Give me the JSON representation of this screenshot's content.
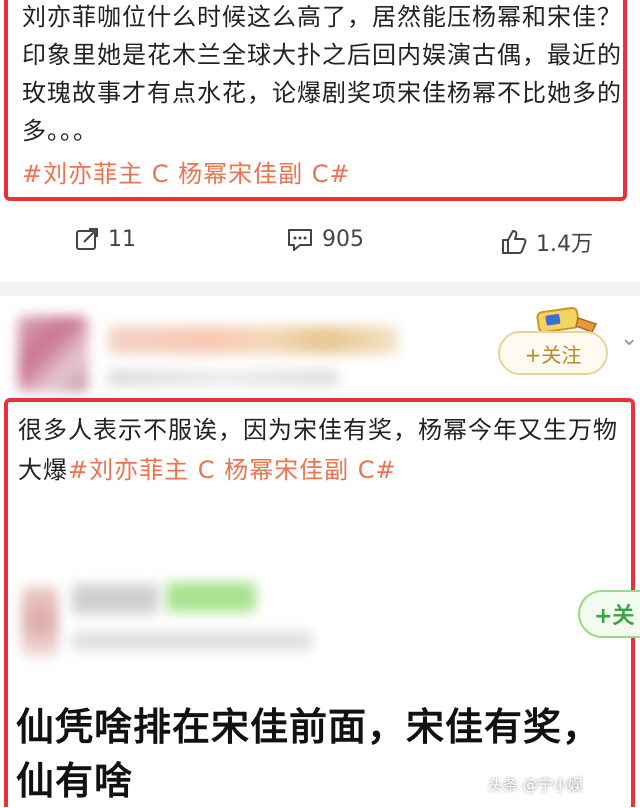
{
  "post1": {
    "text": "刘亦菲咖位什么时候这么高了，居然能压杨幂和宋佳？印象里她是花木兰全球大扑之后回内娱演古偶，最近的玫瑰故事才有点水花，论爆剧奖项宋佳杨幂不比她多的多。。。",
    "hashtag": "#刘亦菲主 C 杨幂宋佳副 C#"
  },
  "actions": {
    "repost_count": "11",
    "comment_count": "905",
    "like_count": "1.4万"
  },
  "comment_header": {
    "follow_label": "+关注"
  },
  "post2": {
    "text": "很多人表示不服诶，因为宋佳有奖，杨幂今年又生万物大爆",
    "hashtag": "#刘亦菲主 C 杨幂宋佳副 C#",
    "inner_follow_label": "+关",
    "big_line1": "仙凭啥排在宋佳前面，宋佳有奖，",
    "big_line2": "仙有啥"
  },
  "watermark": {
    "text": "头条 @宁小娱"
  },
  "colors": {
    "frame": "#e8313a",
    "hashtag": "#eb7350",
    "follow_gold": "#b48a2e",
    "follow_green": "#3aa544"
  }
}
